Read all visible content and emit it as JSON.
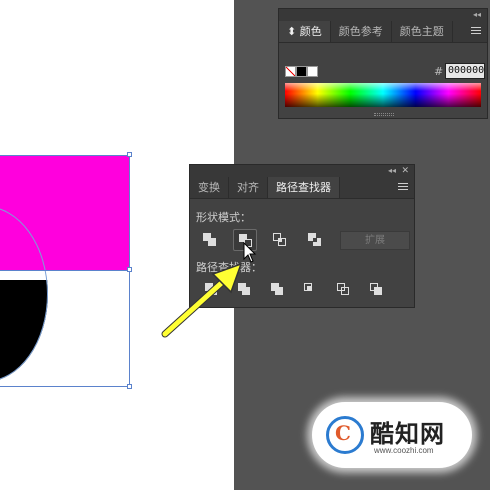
{
  "color_panel": {
    "tabs": [
      {
        "label": "颜色",
        "active": true
      },
      {
        "label": "颜色参考",
        "active": false
      },
      {
        "label": "颜色主题",
        "active": false
      }
    ],
    "hash": "#",
    "hex_value": "000000",
    "fill_color": "#000000",
    "stroke_color": "#ffffff"
  },
  "pathfinder_panel": {
    "tabs": [
      {
        "label": "变换",
        "active": false
      },
      {
        "label": "对齐",
        "active": false
      },
      {
        "label": "路径查找器",
        "active": true
      }
    ],
    "shape_modes_label": "形状模式：",
    "pathfinders_label": "路径查找器：",
    "expand_label": "扩展"
  },
  "artwork": {
    "magenta": "#ff00dd",
    "black": "#000000",
    "selection_color": "#5b82cc"
  },
  "watermark": {
    "logo_letter": "C",
    "title": "酷知网",
    "url": "www.coozhi.com"
  },
  "accent": {
    "arrow_color": "#ffff33"
  }
}
